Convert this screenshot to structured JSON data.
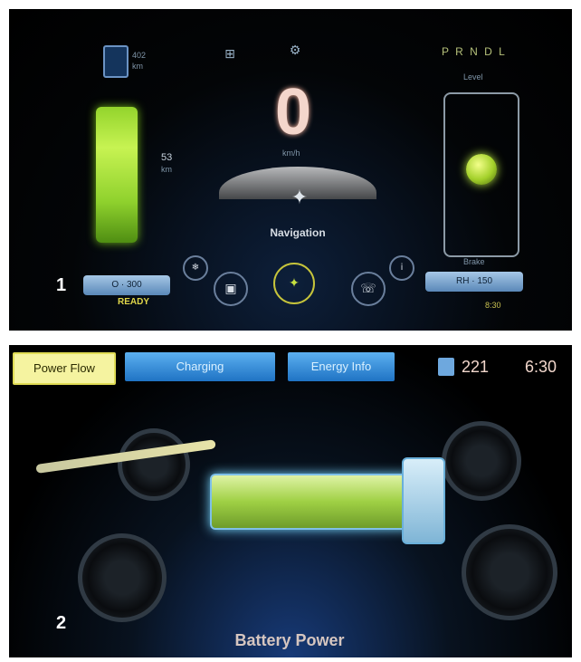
{
  "panel1": {
    "number_label": "1",
    "fuel_value": "402",
    "fuel_unit": "km",
    "battery_value": "53",
    "battery_unit": "km",
    "speed_value": "0",
    "speed_unit": "km/h",
    "nav_label": "Navigation",
    "gear_indicator": "P R N D L",
    "right_top_label": "Level",
    "right_bottom_label": "Brake",
    "left_pill_text": "O · 300",
    "right_pill_text": "RH · 150",
    "ready_text": "READY",
    "time": "8:30",
    "top_icons": [
      "fuel-icon",
      "seat-icon",
      "gear-icon"
    ],
    "bottom_buttons": [
      "climate-button",
      "audio-button",
      "navigation-button",
      "phone-button"
    ],
    "colors": {
      "accent_green": "#a6e03a",
      "pill_blue": "#6a9bd0",
      "text_light": "#d7dde4"
    }
  },
  "panel2": {
    "number_label": "2",
    "tabs": [
      {
        "label": "Power Flow",
        "active": true
      },
      {
        "label": "Charging",
        "active": false
      },
      {
        "label": "Energy Info",
        "active": false
      }
    ],
    "range_value": "221",
    "time": "6:30",
    "caption": "Battery Power",
    "colors": {
      "tab_active": "#f5f3a0",
      "tab_inactive": "#2f84d0",
      "battery_green": "#9fd044"
    }
  }
}
